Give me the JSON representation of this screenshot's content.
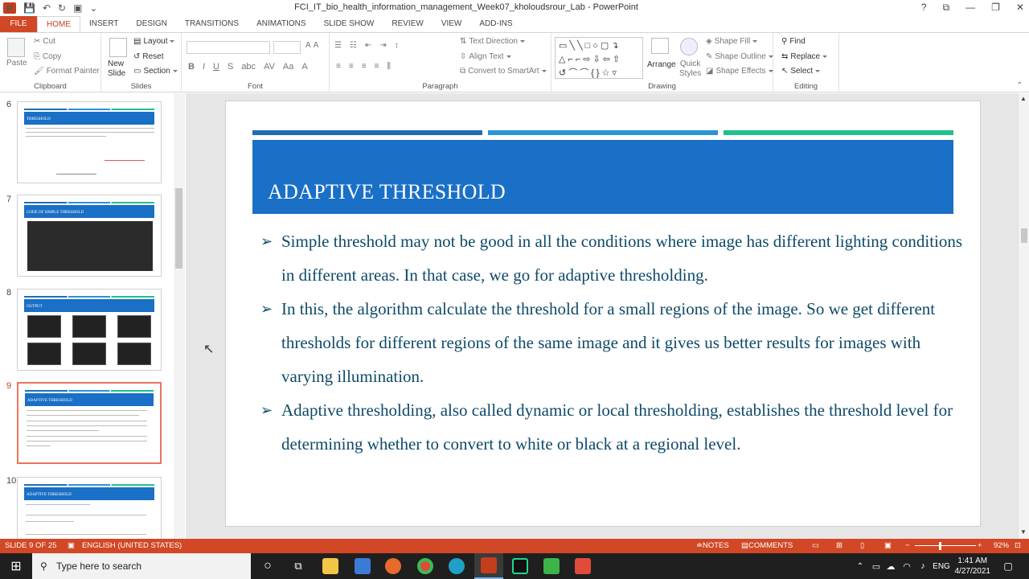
{
  "window": {
    "title": "FCI_IT_bio_health_information_management_Week07_kholoudsrour_Lab  -  PowerPoint",
    "controls": [
      "?",
      "⧉",
      "—",
      "❐",
      "✕"
    ]
  },
  "tabs": [
    "FILE",
    "HOME",
    "INSERT",
    "DESIGN",
    "TRANSITIONS",
    "ANIMATIONS",
    "SLIDE SHOW",
    "REVIEW",
    "VIEW",
    "ADD-INS"
  ],
  "ribbon": {
    "clipboard": {
      "label": "Clipboard",
      "paste": "Paste",
      "cut": "Cut",
      "copy": "Copy",
      "format_painter": "Format Painter"
    },
    "slides": {
      "label": "Slides",
      "new_slide": "New\nSlide",
      "layout": "Layout",
      "reset": "Reset",
      "section": "Section"
    },
    "font": {
      "label": "Font"
    },
    "paragraph": {
      "label": "Paragraph",
      "text_direction": "Text Direction",
      "align_text": "Align Text",
      "convert": "Convert to SmartArt"
    },
    "drawing": {
      "label": "Drawing",
      "arrange": "Arrange",
      "quick_styles": "Quick\nStyles",
      "shape_fill": "Shape Fill",
      "shape_outline": "Shape Outline",
      "shape_effects": "Shape Effects"
    },
    "editing": {
      "label": "Editing",
      "find": "Find",
      "replace": "Replace",
      "select": "Select"
    }
  },
  "thumbnails": [
    {
      "num": "6",
      "title": "THRESHOLD"
    },
    {
      "num": "7",
      "title": "CODE OF SIMPLE THRESHOLD"
    },
    {
      "num": "8",
      "title": "OUTPUT"
    },
    {
      "num": "9",
      "title": "ADAPTIVE THRESHOLD"
    },
    {
      "num": "10",
      "title": "ADAPTIVE THRESHOLD"
    }
  ],
  "slide": {
    "title": "ADAPTIVE THRESHOLD",
    "bullets": [
      "Simple threshold may not be good in all the conditions where image has different lighting conditions in different areas. In that case, we go for adaptive thresholding.",
      " In this, the algorithm calculate the threshold for a small regions of the image. So we get different thresholds for different regions of the same image and it gives us better results for images with varying illumination.",
      "Adaptive thresholding, also called dynamic or local thresholding, establishes the threshold level for determining whether to convert to white or black at a regional level."
    ],
    "colors": {
      "header": "#1a6fc6",
      "stripe1": "#1f6fb5",
      "stripe2": "#2b93d6",
      "stripe3": "#21c08b",
      "text": "#0e4a68"
    }
  },
  "status": {
    "slide": "SLIDE 9 OF 25",
    "language": "ENGLISH (UNITED STATES)",
    "notes": "NOTES",
    "comments": "COMMENTS",
    "zoom": "92%"
  },
  "taskbar": {
    "search_placeholder": "Type here to search",
    "lang": "ENG",
    "time": "1:41 AM",
    "date": "4/27/2021"
  }
}
